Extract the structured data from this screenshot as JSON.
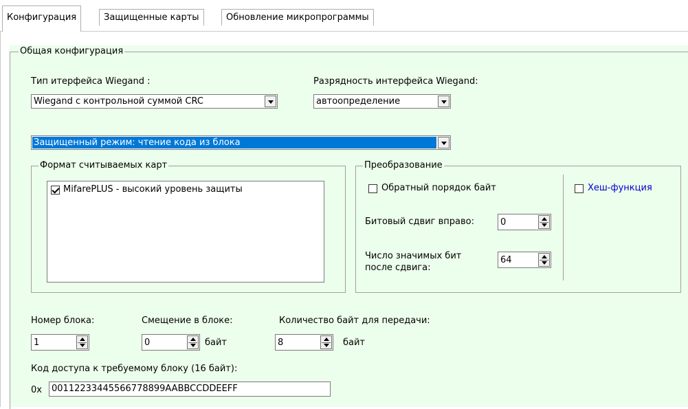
{
  "tabs": [
    {
      "label": "Конфигурация"
    },
    {
      "label": "Защищенные карты"
    },
    {
      "label": "Обновление микропрограммы"
    }
  ],
  "general": {
    "title": "Общая конфигурация",
    "wiegand_type_label": "Тип итерфейса Wiegand :",
    "wiegand_type_value": "Wiegand с контрольной суммой CRC",
    "wiegand_bits_label": "Разрядность интерфейса Wiegand:",
    "wiegand_bits_value": "автоопределение",
    "mode_value": "Защищенный режим: чтение кода из блока"
  },
  "card_format": {
    "title": "Формат считываемых карт",
    "items": [
      {
        "label": "MifarePLUS - высокий уровень защиты",
        "checked": true
      }
    ]
  },
  "conversion": {
    "title": "Преобразование",
    "reverse_label": "Обратный порядок байт",
    "hash_label": "Хеш-функция",
    "shift_label": "Битовый сдвиг вправо:",
    "shift_value": "0",
    "sigbits_label_1": "Число значимых бит",
    "sigbits_label_2": "после сдвига:",
    "sigbits_value": "64"
  },
  "block": {
    "number_label": "Номер блока:",
    "number_value": "1",
    "offset_label": "Смещение в блоке:",
    "offset_value": "0",
    "offset_unit": "байт",
    "count_label": "Количество байт для передачи:",
    "count_value": "8",
    "count_unit": "байт",
    "access_label": "Код доступа к требуемому блоку (16 байт):",
    "access_prefix": "0x",
    "access_value": "00112233445566778899AABBCCDDEEFF"
  },
  "colors": {
    "panel_bg": "#ecfeec",
    "selection": "#0078d7",
    "link": "#0000cc"
  }
}
